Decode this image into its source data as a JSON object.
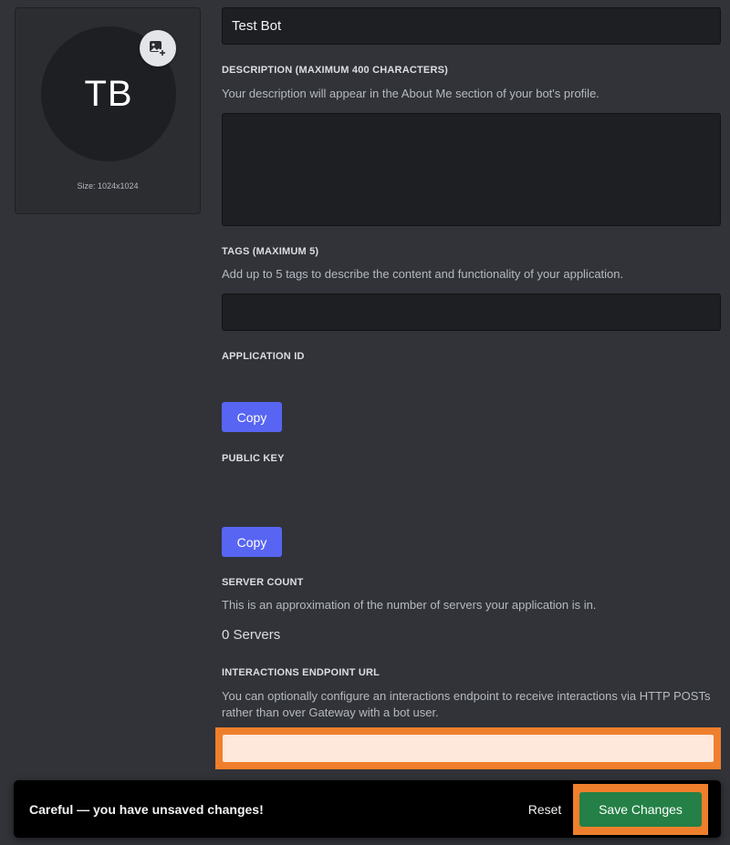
{
  "avatar": {
    "initials": "TB",
    "size_text": "Size: 1024x1024",
    "upload_icon": "image-plus-icon"
  },
  "name_field": {
    "value": "Test Bot"
  },
  "description": {
    "label": "DESCRIPTION (MAXIMUM 400 CHARACTERS)",
    "help": "Your description will appear in the About Me section of your bot's profile.",
    "value": ""
  },
  "tags": {
    "label": "TAGS (MAXIMUM 5)",
    "help": "Add up to 5 tags to describe the content and functionality of your application.",
    "value": ""
  },
  "application_id": {
    "label": "APPLICATION ID",
    "value": "",
    "copy_label": "Copy"
  },
  "public_key": {
    "label": "PUBLIC KEY",
    "value": "",
    "copy_label": "Copy"
  },
  "server_count": {
    "label": "SERVER COUNT",
    "help": "This is an approximation of the number of servers your application is in.",
    "value": "0 Servers"
  },
  "interactions_endpoint": {
    "label": "INTERACTIONS ENDPOINT URL",
    "help": "You can optionally configure an interactions endpoint to receive interactions via HTTP POSTs rather than over Gateway with a bot user.",
    "value": ""
  },
  "unsaved_bar": {
    "message": "Careful — you have unsaved changes!",
    "reset_label": "Reset",
    "save_label": "Save Changes"
  },
  "colors": {
    "background": "#313338",
    "input": "#1e1f22",
    "blurple": "#5865f2",
    "save_green": "#248046",
    "highlight_orange": "#ef7f2c"
  }
}
